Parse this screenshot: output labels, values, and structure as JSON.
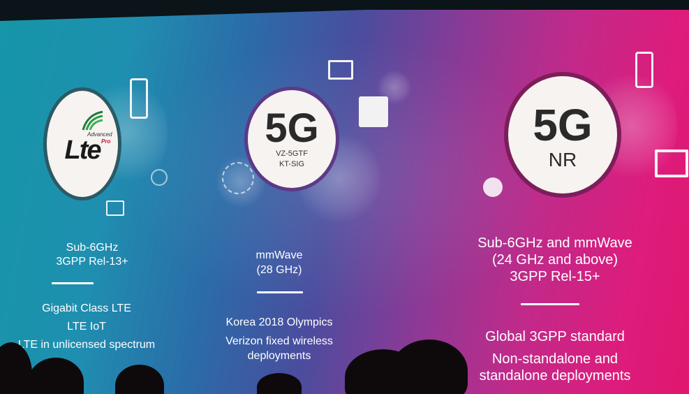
{
  "columns": [
    {
      "logo": {
        "word": "Lte",
        "advanced": "Advanced",
        "pro": "Pro"
      },
      "spec_lines": [
        "Sub-6GHz",
        "3GPP Rel-13+"
      ],
      "feature_lines": [
        "Gigabit Class LTE",
        "LTE IoT",
        "LTE in unlicensed spectrum"
      ]
    },
    {
      "logo": {
        "big": "5G",
        "sub1": "VZ-5GTF",
        "sub2": "KT-SIG"
      },
      "spec_lines": [
        "mmWave",
        "(28 GHz)"
      ],
      "feature_lines": [
        "Korea 2018 Olympics",
        "Verizon fixed wireless",
        "deployments"
      ]
    },
    {
      "logo": {
        "big": "5G",
        "sub": "NR"
      },
      "spec_lines": [
        "Sub-6GHz and mmWave",
        "(24 GHz and above)",
        "3GPP Rel-15+"
      ],
      "feature_lines": [
        "Global 3GPP standard",
        "Non-standalone and",
        "standalone deployments"
      ]
    }
  ],
  "icons": [
    "phone-icon",
    "tablet-icon",
    "monitor-icon",
    "router-icon",
    "location-pin-icon",
    "drone-icon",
    "sun-icon"
  ],
  "colors": {
    "left": "#1596a7",
    "middle": "#4a4d9e",
    "right": "#e0166f",
    "badge": "#f7f3f1"
  }
}
